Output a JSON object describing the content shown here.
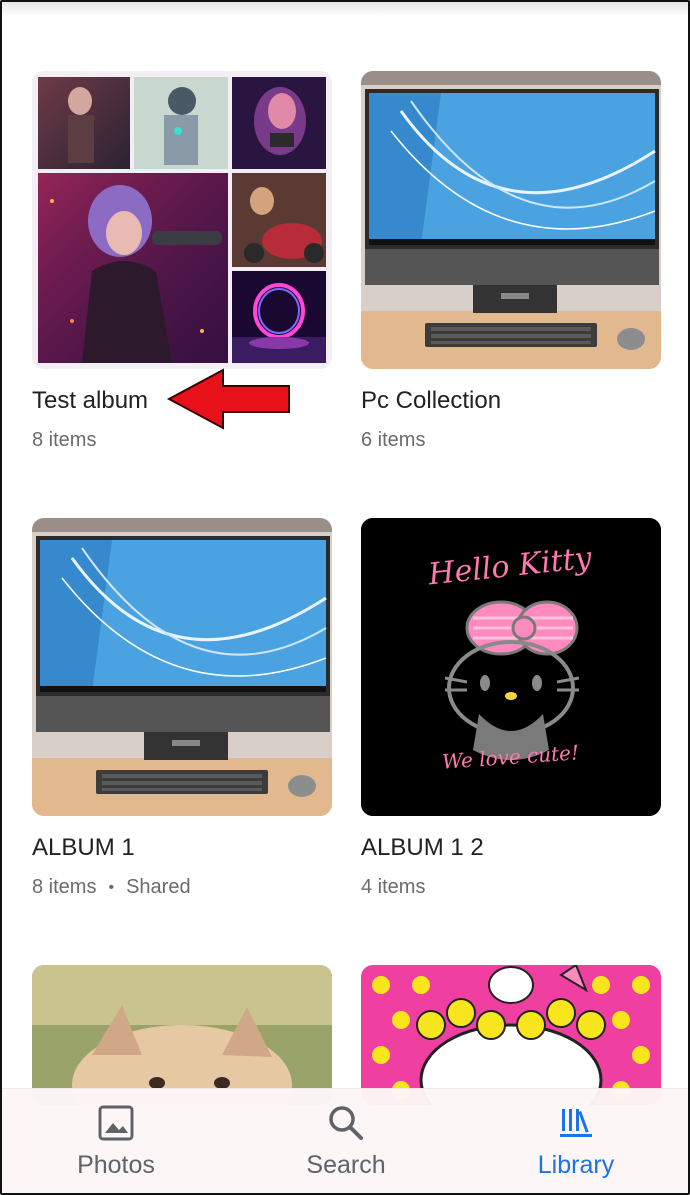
{
  "albums": [
    {
      "title": "Test album",
      "count": "8 items",
      "extra": ""
    },
    {
      "title": "Pc Collection",
      "count": "6 items",
      "extra": ""
    },
    {
      "title": "ALBUM 1",
      "count": "8 items",
      "extra": "Shared"
    },
    {
      "title": "ALBUM 1 2",
      "count": "4 items",
      "extra": ""
    }
  ],
  "hello_kitty": {
    "headline": "Hello Kitty",
    "tagline": "We love cute!"
  },
  "nav": {
    "items": [
      {
        "label": "Photos",
        "icon": "photo-icon",
        "active": false
      },
      {
        "label": "Search",
        "icon": "search-icon",
        "active": false
      },
      {
        "label": "Library",
        "icon": "library-icon",
        "active": true
      }
    ]
  },
  "colors": {
    "accent": "#1a73e8",
    "inactive": "#5f6368",
    "annotation_arrow": "#e8111a"
  }
}
